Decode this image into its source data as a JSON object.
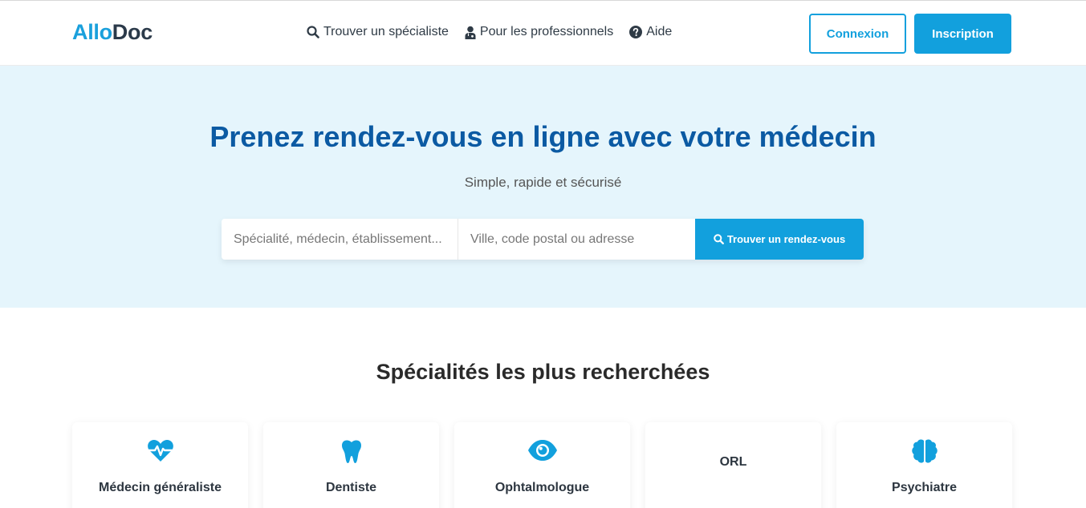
{
  "brand": {
    "part1": "Allo",
    "part2": "Doc"
  },
  "nav": [
    {
      "label": "Trouver un spécialiste",
      "icon": "search-icon"
    },
    {
      "label": "Pour les professionnels",
      "icon": "doctor-icon"
    },
    {
      "label": "Aide",
      "icon": "help-circle-icon"
    }
  ],
  "auth": {
    "login": "Connexion",
    "signup": "Inscription"
  },
  "hero": {
    "title": "Prenez rendez-vous en ligne avec votre médecin",
    "subtitle": "Simple, rapide et sécurisé",
    "search_specialty_placeholder": "Spécialité, médecin, établissement...",
    "search_location_placeholder": "Ville, code postal ou adresse",
    "search_button": "Trouver un rendez-vous"
  },
  "specialties": {
    "title": "Spécialités les plus recherchées",
    "items": [
      {
        "label": "Médecin généraliste",
        "icon": "heartbeat-icon"
      },
      {
        "label": "Dentiste",
        "icon": "tooth-icon"
      },
      {
        "label": "Ophtalmologue",
        "icon": "eye-icon"
      },
      {
        "label": "ORL",
        "icon": ""
      },
      {
        "label": "Psychiatre",
        "icon": "brain-icon"
      }
    ]
  },
  "colors": {
    "accent": "#12a0dd",
    "heading": "#0b5aa3",
    "hero_bg": "#e5f5fc"
  }
}
